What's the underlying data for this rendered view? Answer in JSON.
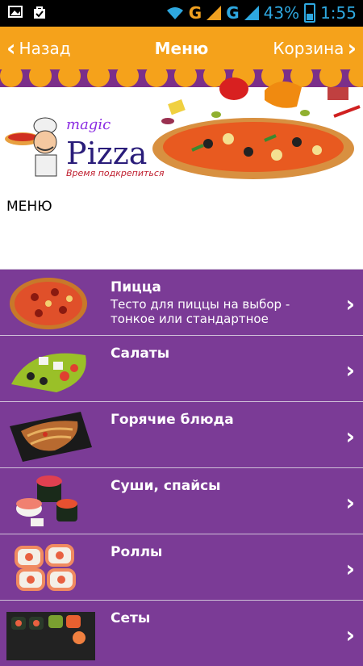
{
  "status_bar": {
    "battery": "43%",
    "time": "1:55",
    "network_1": "G",
    "network_2": "G"
  },
  "action_bar": {
    "back_label": "Назад",
    "title": "Меню",
    "cart_label": "Корзина"
  },
  "banner": {
    "logo_magic": "magic",
    "logo_pizza": "Pizza",
    "logo_tagline": "Время подкрепиться"
  },
  "page": {
    "heading": "МЕНЮ"
  },
  "menu": {
    "items": [
      {
        "title": "Пицца",
        "description": "Тесто для пиццы на выбор - тонкое или стандартное"
      },
      {
        "title": "Салаты",
        "description": ""
      },
      {
        "title": "Горячие блюда",
        "description": ""
      },
      {
        "title": "Суши, спайсы",
        "description": ""
      },
      {
        "title": "Роллы",
        "description": ""
      },
      {
        "title": "Сеты",
        "description": ""
      }
    ]
  },
  "colors": {
    "accent_orange": "#f5a21b",
    "menu_purple": "#7b3b96"
  }
}
